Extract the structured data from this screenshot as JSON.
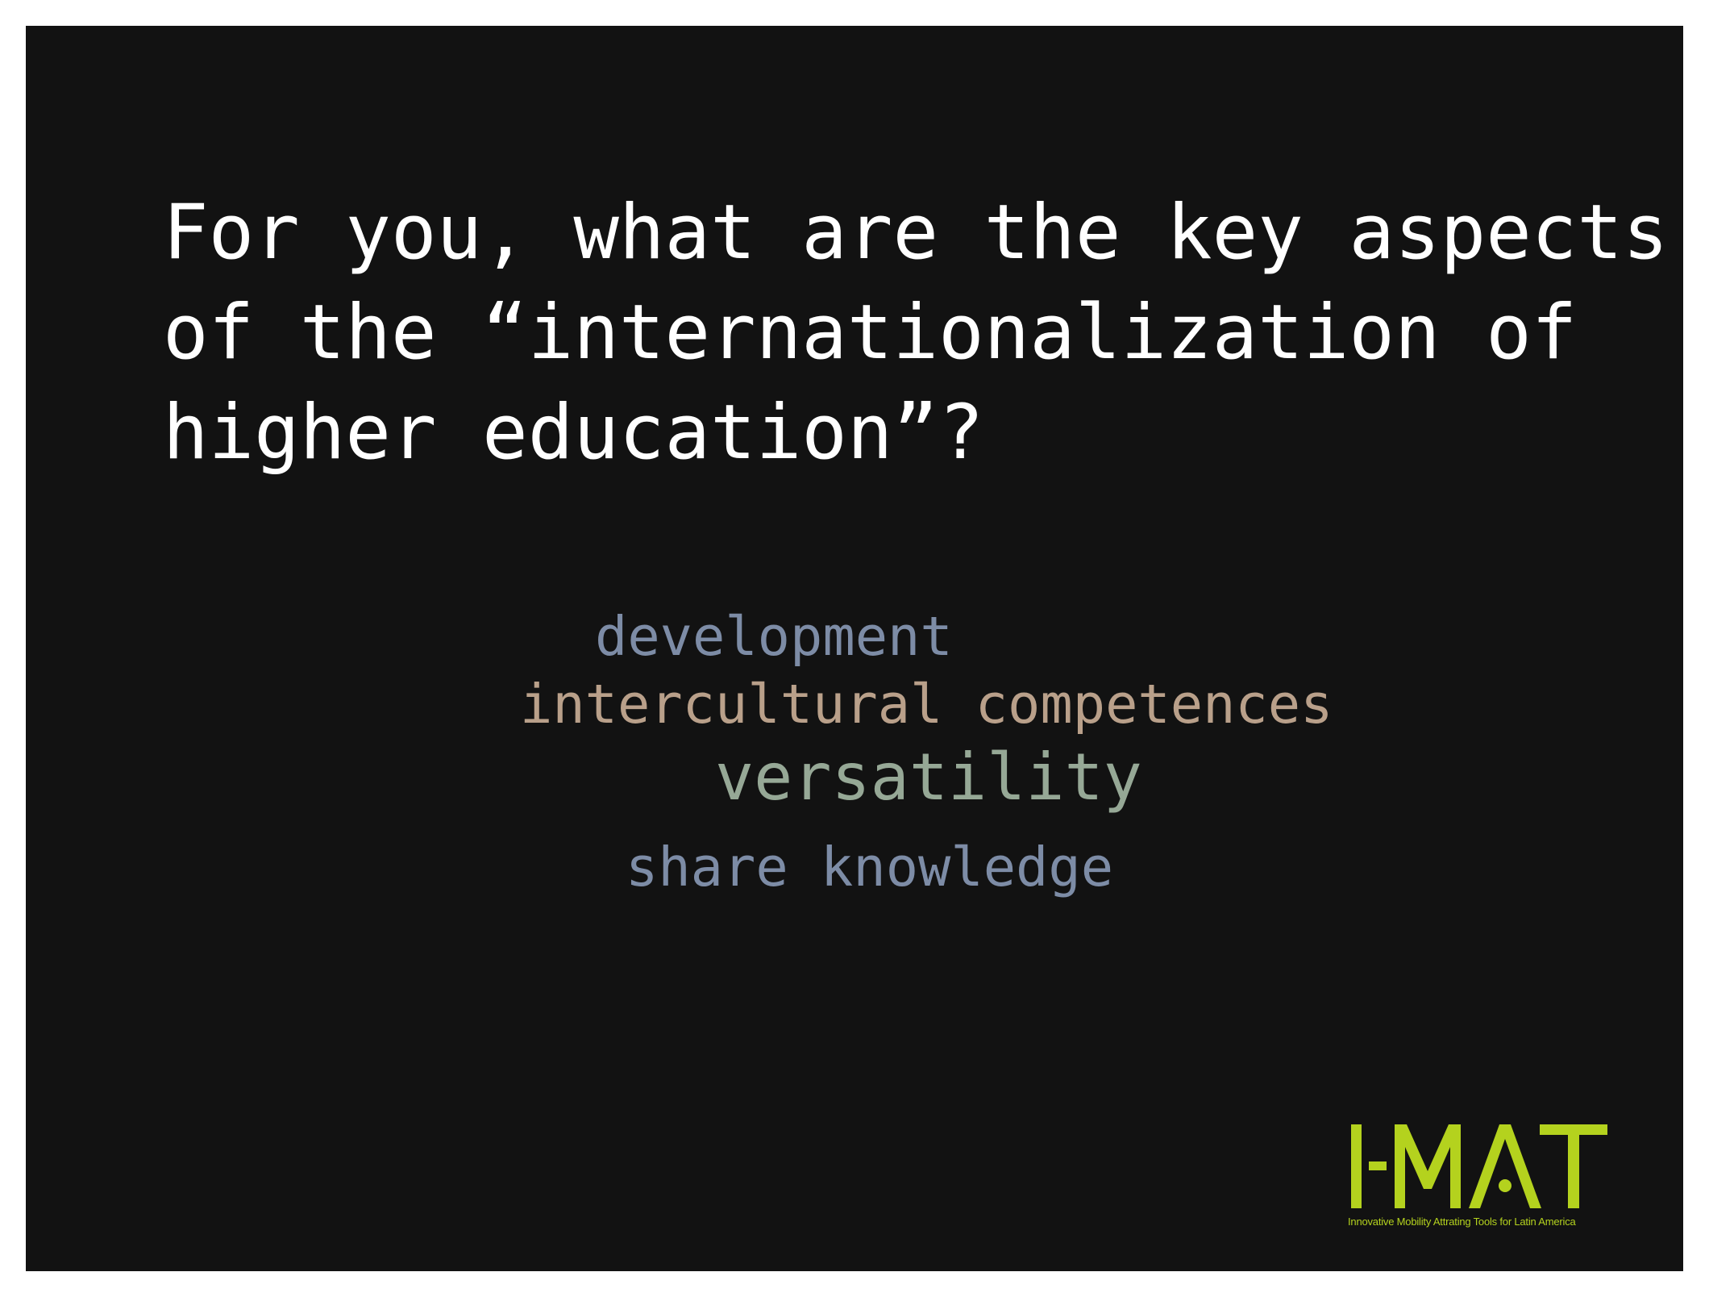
{
  "question": {
    "lines": [
      "For you, what are the key aspects",
      "of the “internationalization of",
      "higher education”?"
    ]
  },
  "word_cloud": {
    "words": [
      {
        "text": "development",
        "color": "#7d8ca6"
      },
      {
        "text": "intercultural competences",
        "color": "#b9a08a"
      },
      {
        "text": "versatility",
        "color": "#96a896"
      },
      {
        "text": "share knowledge",
        "color": "#7d8ca6"
      }
    ]
  },
  "logo": {
    "name": "I-MAT",
    "tagline": "Innovative Mobility Attrating Tools for Latin America",
    "color": "#b4d21e"
  }
}
